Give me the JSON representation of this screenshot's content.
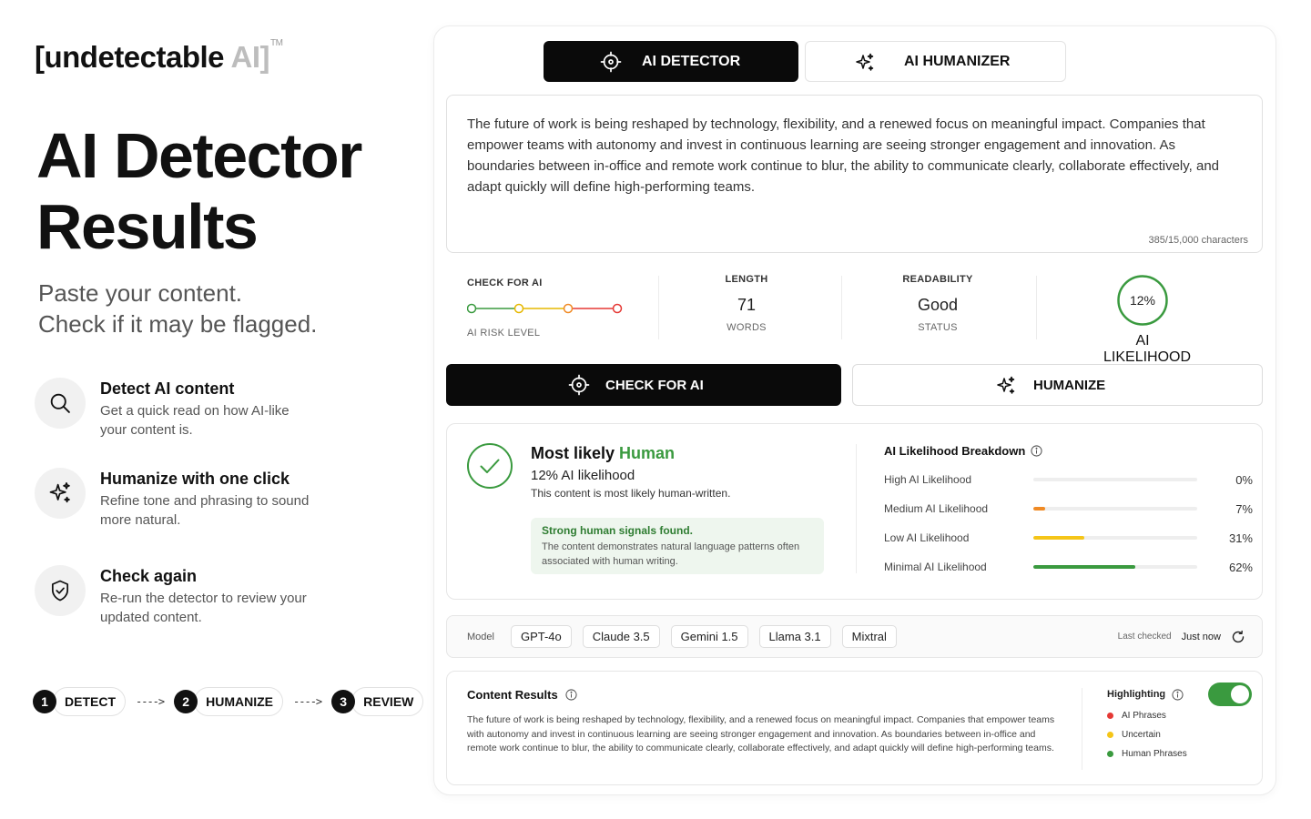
{
  "brand": {
    "main": "[undetectable ",
    "accent": "AI]",
    "tm": "TM"
  },
  "hero": {
    "title_line1": "AI Detector",
    "title_line2": "Results",
    "sub_line1": "Paste your content.",
    "sub_line2": "Check if it may be flagged."
  },
  "features": [
    {
      "title": "Detect AI content",
      "desc": "Get a quick read on how AI-like your content is.",
      "icon": "search-icon"
    },
    {
      "title": "Humanize with one click",
      "desc": "Refine tone and phrasing to sound more natural.",
      "icon": "sparkle-icon"
    },
    {
      "title": "Check again",
      "desc": "Re-run the detector to review your updated content.",
      "icon": "shield-check-icon"
    }
  ],
  "steps": [
    {
      "num": "1",
      "label": "DETECT"
    },
    {
      "num": "2",
      "label": "HUMANIZE"
    },
    {
      "num": "3",
      "label": "REVIEW"
    }
  ],
  "step_arrow": "---->",
  "tabs": {
    "detector": "AI DETECTOR",
    "humanizer": "AI HUMANIZER"
  },
  "input": {
    "text": "The future of work is being reshaped by technology, flexibility, and a renewed focus on meaningful impact. Companies that empower teams with autonomy and invest in continuous learning are seeing stronger engagement and innovation. As boundaries between in-office and remote work continue to blur, the ability to communicate clearly, collaborate effectively, and adapt quickly will define high-performing teams.",
    "char_count": "385/15,000 characters"
  },
  "metrics": {
    "check_label": "CHECK FOR AI",
    "risk_label": "AI RISK LEVEL",
    "risk_colors": [
      "#3a9a3f",
      "#e6b800",
      "#f08a24",
      "#e53935"
    ],
    "length_label": "LENGTH",
    "length_value": "71",
    "length_unit": "WORDS",
    "readability_label": "READABILITY",
    "readability_value": "Good",
    "readability_status": "STATUS",
    "likelihood_value": "12%",
    "likelihood_fraction": 0.12,
    "likelihood_label": "AI LIKELIHOOD"
  },
  "actions": {
    "check": "CHECK FOR AI",
    "humanize": "HUMANIZE"
  },
  "result": {
    "verdict_prefix": "Most likely ",
    "verdict_word": "Human",
    "likelihood": "12% AI likelihood",
    "description": "This content is most likely human-written.",
    "signal_title": "Strong human signals found.",
    "signal_desc": "The content demonstrates natural language patterns often associated with human writing.",
    "breakdown_title": "AI Likelihood Breakdown",
    "breakdown": [
      {
        "label": "High AI Likelihood",
        "pct": "0%",
        "value": 0,
        "color": "#e53935"
      },
      {
        "label": "Medium AI Likelihood",
        "pct": "7%",
        "value": 0.07,
        "color": "#f08a24"
      },
      {
        "label": "Low AI Likelihood",
        "pct": "31%",
        "value": 0.31,
        "color": "#f5c518"
      },
      {
        "label": "Minimal AI Likelihood",
        "pct": "62%",
        "value": 0.62,
        "color": "#3a9a3f"
      }
    ]
  },
  "models": {
    "label": "Model",
    "items": [
      "GPT-4o",
      "Claude 3.5",
      "Gemini 1.5",
      "Llama 3.1",
      "Mixtral"
    ],
    "last_checked_label": "Last checked",
    "last_checked_value": "Just now"
  },
  "content_results": {
    "title": "Content Results",
    "text": "The future of work is being reshaped by technology, flexibility, and a renewed focus on meaningful impact. Companies that empower teams with autonomy and invest in continuous learning are seeing stronger engagement and innovation. As boundaries between in-office and remote work continue to blur, the ability to communicate clearly, collaborate effectively, and adapt quickly will define high-performing teams.",
    "highlighting_label": "Highlighting",
    "highlighting_on": true,
    "legend": [
      {
        "label": "AI Phrases",
        "color": "#e53935"
      },
      {
        "label": "Uncertain",
        "color": "#f5c518"
      },
      {
        "label": "Human Phrases",
        "color": "#3a9a3f"
      }
    ]
  }
}
